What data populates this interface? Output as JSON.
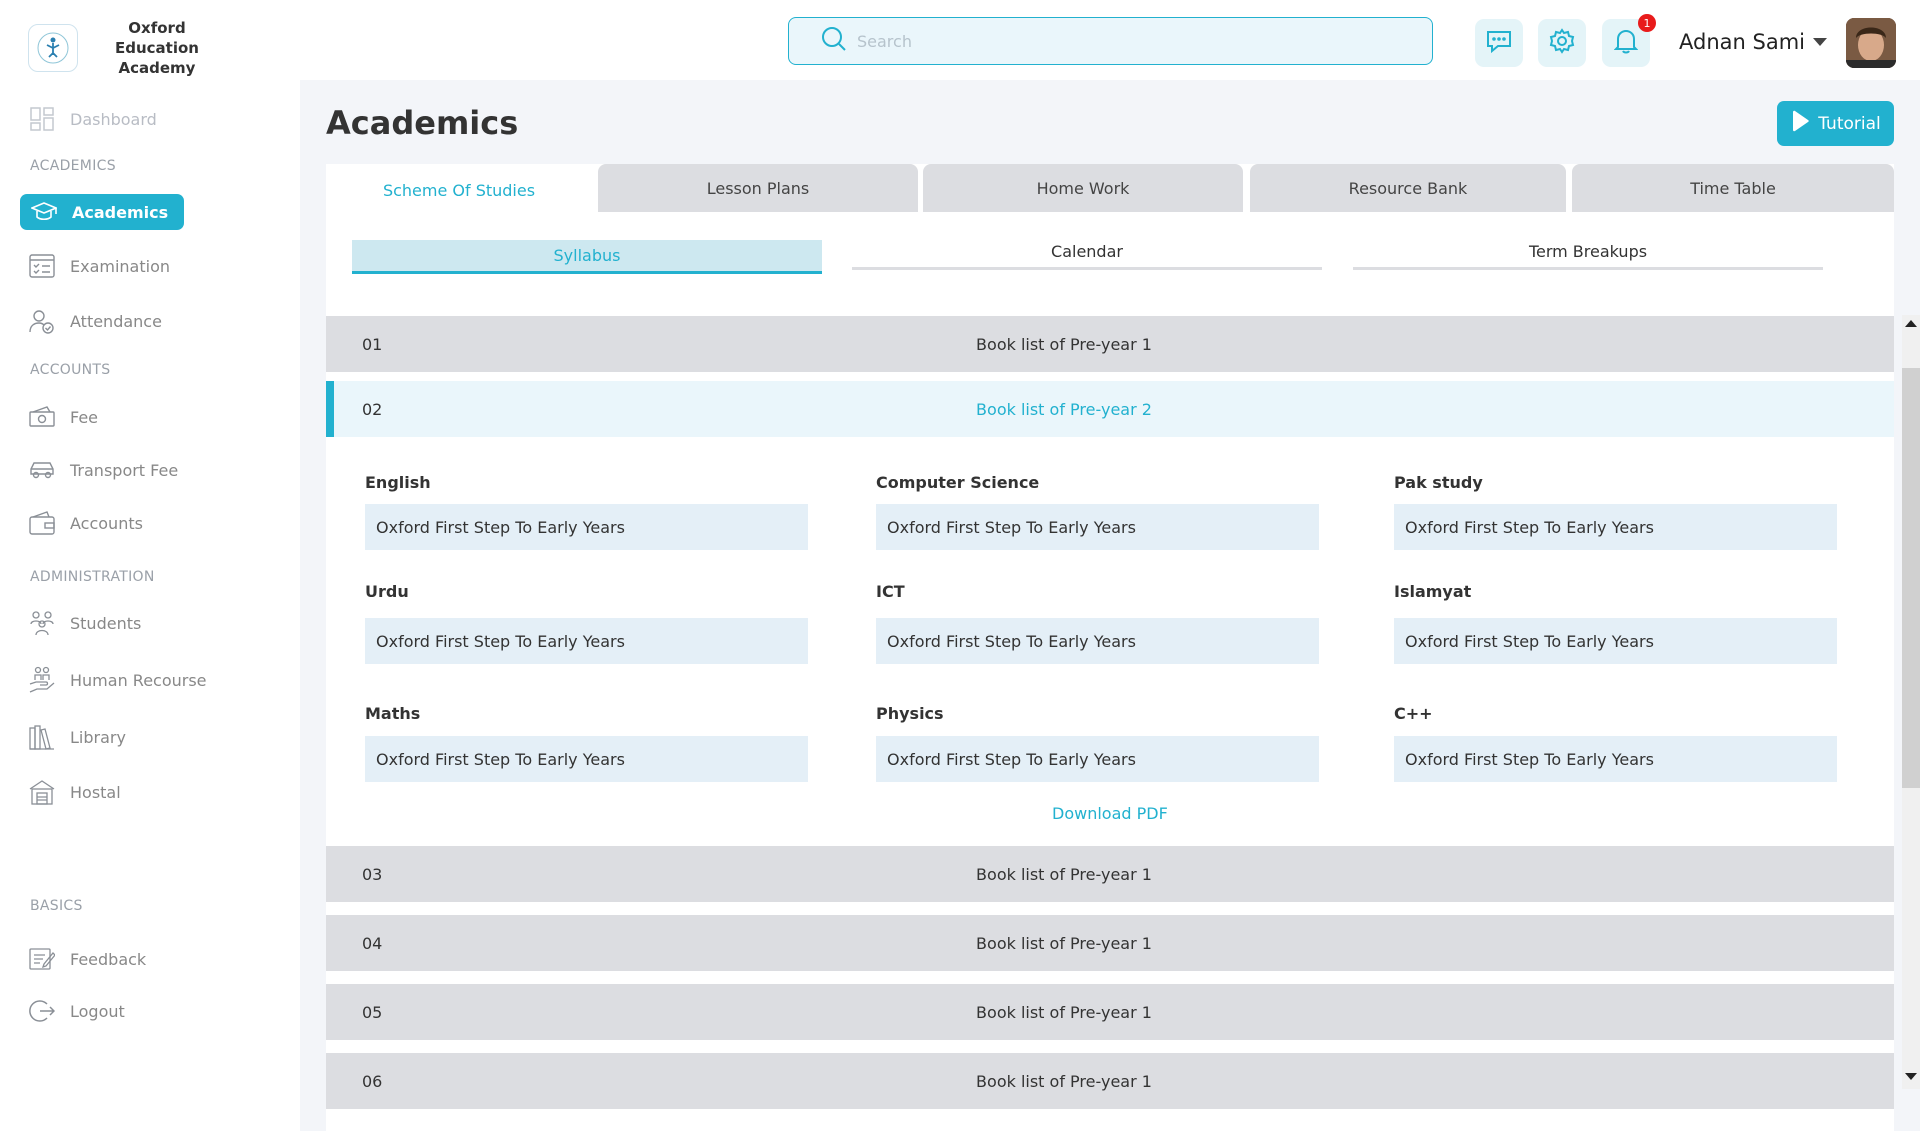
{
  "brand": {
    "name_line1": "Oxford Education",
    "name_line2": "Academy"
  },
  "search": {
    "placeholder": "Search"
  },
  "user": {
    "name": "Adnan Sami",
    "notification_count": "1"
  },
  "page": {
    "title": "Academics",
    "tutorial_label": "Tutorial"
  },
  "sidebar": {
    "dashboard": "Dashboard",
    "sections": {
      "academics": "ACADEMICS",
      "accounts": "ACCOUNTS",
      "administration": "ADMINISTRATION",
      "basics": "BASICS"
    },
    "items": {
      "academics": "Academics",
      "examination": "Examination",
      "attendance": "Attendance",
      "fee": "Fee",
      "transport_fee": "Transport Fee",
      "accounts": "Accounts",
      "students": "Students",
      "human_resource": "Human Recourse",
      "library": "Library",
      "hostal": "Hostal",
      "feedback": "Feedback",
      "logout": "Logout"
    }
  },
  "tabs": [
    "Scheme Of Studies",
    "Lesson Plans",
    "Home Work",
    "Resource Bank",
    "Time Table"
  ],
  "subtabs": [
    "Syllabus",
    "Calendar",
    "Term Breakups"
  ],
  "rows": [
    {
      "num": "01",
      "label": "Book list of Pre-year 1"
    },
    {
      "num": "02",
      "label": "Book list of Pre-year 2"
    },
    {
      "num": "03",
      "label": "Book list of Pre-year 1"
    },
    {
      "num": "04",
      "label": "Book list of Pre-year 1"
    },
    {
      "num": "05",
      "label": "Book list of Pre-year 1"
    },
    {
      "num": "06",
      "label": "Book list of Pre-year 1"
    }
  ],
  "subjects": [
    {
      "name": "English",
      "book": "Oxford First Step To Early Years"
    },
    {
      "name": "Computer Science",
      "book": "Oxford First Step To Early Years"
    },
    {
      "name": "Pak study",
      "book": "Oxford First Step To Early Years"
    },
    {
      "name": "Urdu",
      "book": "Oxford First Step To Early Years"
    },
    {
      "name": "ICT",
      "book": "Oxford First Step To Early Years"
    },
    {
      "name": "Islamyat",
      "book": "Oxford First Step To Early Years"
    },
    {
      "name": "Maths",
      "book": "Oxford First Step To Early Years"
    },
    {
      "name": "Physics",
      "book": "Oxford First Step To Early Years"
    },
    {
      "name": "C++",
      "book": "Oxford First Step To Early Years"
    }
  ],
  "download_label": "Download PDF",
  "colors": {
    "accent": "#22b1cf",
    "badge": "#e81b1b",
    "tab_inactive": "#dcdde1"
  }
}
